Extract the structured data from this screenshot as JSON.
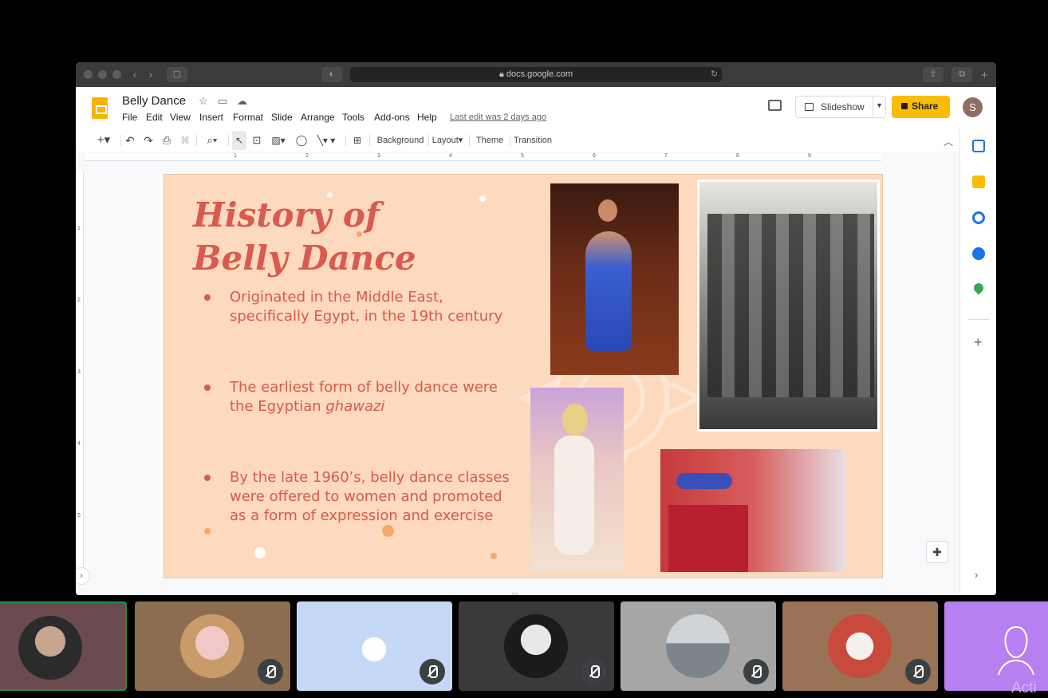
{
  "browser": {
    "url": "docs.google.com"
  },
  "docs": {
    "title": "Belly Dance",
    "menu": [
      "File",
      "Edit",
      "View",
      "Insert",
      "Format",
      "Slide",
      "Arrange",
      "Tools",
      "Add-ons",
      "Help"
    ],
    "last_edit": "Last edit was 2 days ago",
    "slideshow_label": "Slideshow",
    "share_label": "Share",
    "account_initial": "S"
  },
  "toolbar": {
    "background_label": "Background",
    "layout_label": "Layout",
    "theme_label": "Theme",
    "transition_label": "Transition"
  },
  "ruler": {
    "horizontal": [
      "1",
      "2",
      "3",
      "4",
      "5",
      "6",
      "7",
      "8",
      "9"
    ],
    "vertical": [
      "1",
      "2",
      "3",
      "4",
      "5"
    ]
  },
  "slide": {
    "title": "History of Belly Dance",
    "bullets": [
      "Originated in the Middle East, specifically Egypt, in the 19th century",
      "The earliest form of belly dance were the Egyptian ",
      "By the late 1960’s, belly dance classes were offered to women and promoted as a form of expression and exercise"
    ],
    "bullet2_italic": "ghawazi",
    "background_color": "#fdd9bd",
    "text_color": "#d95a4e"
  },
  "side_panel": {
    "icons": [
      "calendar-icon",
      "keep-icon",
      "tasks-icon",
      "contacts-icon",
      "maps-icon",
      "add-icon"
    ]
  },
  "participants": {
    "count": 7,
    "watermark_text": "Acti"
  }
}
